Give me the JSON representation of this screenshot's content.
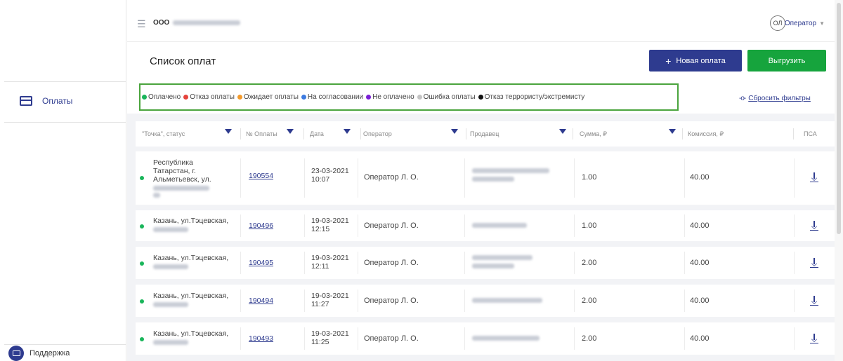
{
  "sidebar": {
    "items": [
      {
        "label": "Оплаты",
        "icon": "card-icon"
      }
    ],
    "support_label": "Поддержка"
  },
  "topbar": {
    "company_prefix": "ООО",
    "avatar_initials": "ОЛ",
    "user_role": "Оператор"
  },
  "header": {
    "title": "Список оплат",
    "new_payment_label": "Новая оплата",
    "export_label": "Выгрузить"
  },
  "legend": [
    {
      "label": "Оплачено",
      "color": "#19b55a"
    },
    {
      "label": "Отказ оплаты",
      "color": "#e5433b"
    },
    {
      "label": "Ожидает оплаты",
      "color": "#f39a2b"
    },
    {
      "label": "На согласовании",
      "color": "#3d7be0"
    },
    {
      "label": "Не оплачено",
      "color": "#7a1fd6"
    },
    {
      "label": "Ошибка оплаты",
      "color": "#c4c4c4"
    },
    {
      "label": "Отказ террористу/экстремисту",
      "color": "#111111"
    }
  ],
  "reset_filters_label": "Сбросить фильтры",
  "table": {
    "columns": [
      "\"Точка\", статус",
      "№ Оплаты",
      "Дата",
      "Оператор",
      "Продавец",
      "Сумма, ₽",
      "Комиссия, ₽",
      "ПСА"
    ],
    "rows": [
      {
        "address": "Республика Татарстан, г. Альметьевск, ул.",
        "payment_no": "190554",
        "date": "23-03-2021",
        "time": "10:07",
        "operator": "Оператор Л. О.",
        "amount": "1.00",
        "commission": "40.00"
      },
      {
        "address": "Казань, ул.Тэцевская,",
        "payment_no": "190496",
        "date": "19-03-2021",
        "time": "12:15",
        "operator": "Оператор Л. О.",
        "amount": "1.00",
        "commission": "40.00"
      },
      {
        "address": "Казань, ул.Тэцевская,",
        "payment_no": "190495",
        "date": "19-03-2021",
        "time": "12:11",
        "operator": "Оператор Л. О.",
        "amount": "2.00",
        "commission": "40.00"
      },
      {
        "address": "Казань, ул.Тэцевская,",
        "payment_no": "190494",
        "date": "19-03-2021",
        "time": "11:27",
        "operator": "Оператор Л. О.",
        "amount": "2.00",
        "commission": "40.00"
      },
      {
        "address": "Казань, ул.Тэцевская,",
        "payment_no": "190493",
        "date": "19-03-2021",
        "time": "11:25",
        "operator": "Оператор Л. О.",
        "amount": "2.00",
        "commission": "40.00"
      }
    ]
  }
}
